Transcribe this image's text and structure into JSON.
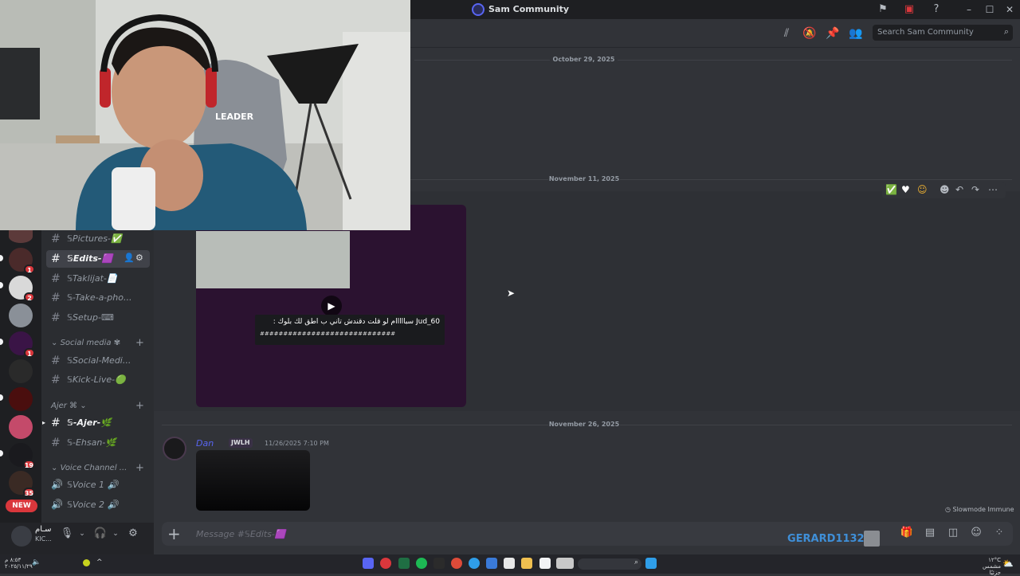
{
  "app": {
    "server_name": "Sam Community"
  },
  "header": {
    "search_placeholder": "Search Sam Community"
  },
  "date_dividers": [
    "October 29, 2025",
    "November 11, 2025",
    "November 26, 2025"
  ],
  "channels": {
    "items": [
      {
        "name": "𝕊Pictures-✅",
        "type": "text"
      },
      {
        "name": "𝕊Edits-🟪",
        "type": "text",
        "active": true
      },
      {
        "name": "𝕊Taklijat-📄",
        "type": "text"
      },
      {
        "name": "𝕊-Take-a-pho...",
        "type": "text"
      },
      {
        "name": "𝕊Setup-⌨",
        "type": "text"
      },
      {
        "name": "𝕊Social-Medi...",
        "type": "text"
      },
      {
        "name": "𝕊Kick-Live-🟢",
        "type": "text"
      },
      {
        "name": "𝕊-Ajer-🌿",
        "type": "text",
        "bold": true
      },
      {
        "name": "𝕊-Ehsan-🌿",
        "type": "text"
      },
      {
        "name": "𝕊Voice 1 🔊",
        "type": "voice"
      },
      {
        "name": "𝕊Voice 2 🔊",
        "type": "voice"
      }
    ],
    "categories": [
      "Social media ✾",
      "Ajer ⌘",
      "Voice Channel ..."
    ]
  },
  "servers": {
    "badges": [
      "1",
      "2",
      "1",
      "19",
      "35"
    ],
    "new_label": "NEW"
  },
  "user": {
    "name": "سـام",
    "status": "KIC..."
  },
  "video": {
    "caption_user": "Jud_60",
    "caption_text": "سبااااام لو قلت دقندش تاني ب اطق لك بلوك :",
    "caption_line2": "#############################"
  },
  "message": {
    "author": "Dan",
    "tag": "JWLH",
    "timestamp": "11/26/2025 7:10 PM"
  },
  "slowmode": "Slowmode Immune",
  "composer": {
    "placeholder": "Message #𝕊Edits-🟪",
    "overlay_name": "GERARD1132"
  },
  "taskbar": {
    "time": "١٢°C",
    "date": "مشمس جزئيًا",
    "left_time": "٨:٥٣ م",
    "left_date": "٢٠٢٥/١١/٢٩"
  }
}
